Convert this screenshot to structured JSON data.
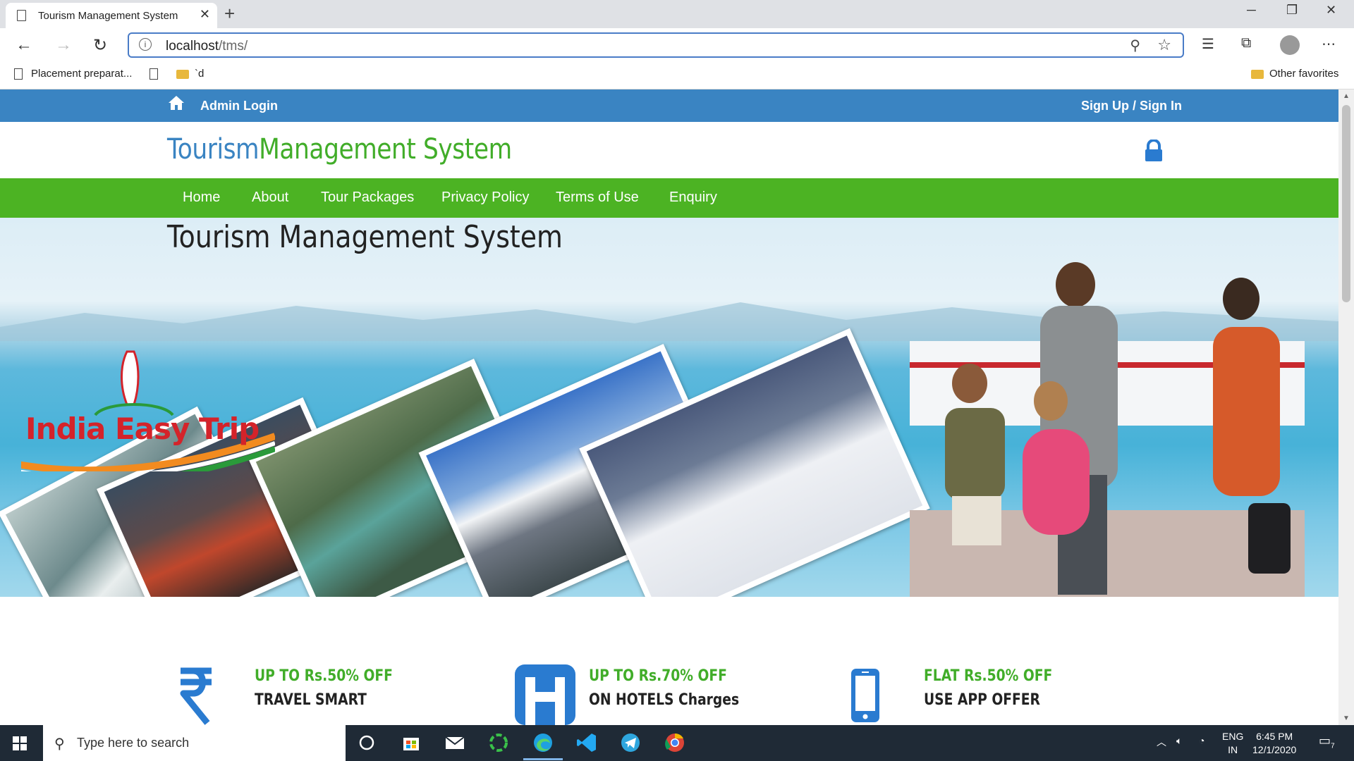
{
  "browser": {
    "tab_title": "Tourism Management System",
    "url_host": "localhost",
    "url_path": "/tms/",
    "favorites": [
      {
        "label": "Placement preparat...",
        "icon": "page-icon"
      },
      {
        "label": "",
        "icon": "page-icon"
      },
      {
        "label": "`d",
        "icon": "folder-icon"
      }
    ],
    "other_favorites": "Other favorites"
  },
  "site": {
    "admin_login": "Admin Login",
    "signup_signin": "Sign Up / Sign In",
    "brand_part1": "Tourism",
    "brand_part2": "Management System",
    "nav": [
      "Home",
      "About",
      "Tour Packages",
      "Privacy Policy",
      "Terms of Use",
      "Enquiry"
    ],
    "hero_title": "Tourism Management System",
    "hero_logo_text": "India Easy Trip",
    "features": [
      {
        "title": "UP TO Rs.50% OFF",
        "subtitle": "TRAVEL SMART",
        "icon": "rupee-icon"
      },
      {
        "title": "UP TO Rs.70% OFF",
        "subtitle": "ON HOTELS Charges",
        "icon": "hotel-icon"
      },
      {
        "title": "FLAT Rs.50% OFF",
        "subtitle": "USE APP OFFER",
        "icon": "mobile-icon"
      }
    ],
    "colors": {
      "blue": "#3a84c2",
      "green": "#4cb323",
      "title_green": "#41ad29"
    }
  },
  "taskbar": {
    "search_placeholder": "Type here to search",
    "lang": "ENG",
    "region": "IN",
    "time": "6:45 PM",
    "date": "12/1/2020",
    "notifications": "7"
  }
}
